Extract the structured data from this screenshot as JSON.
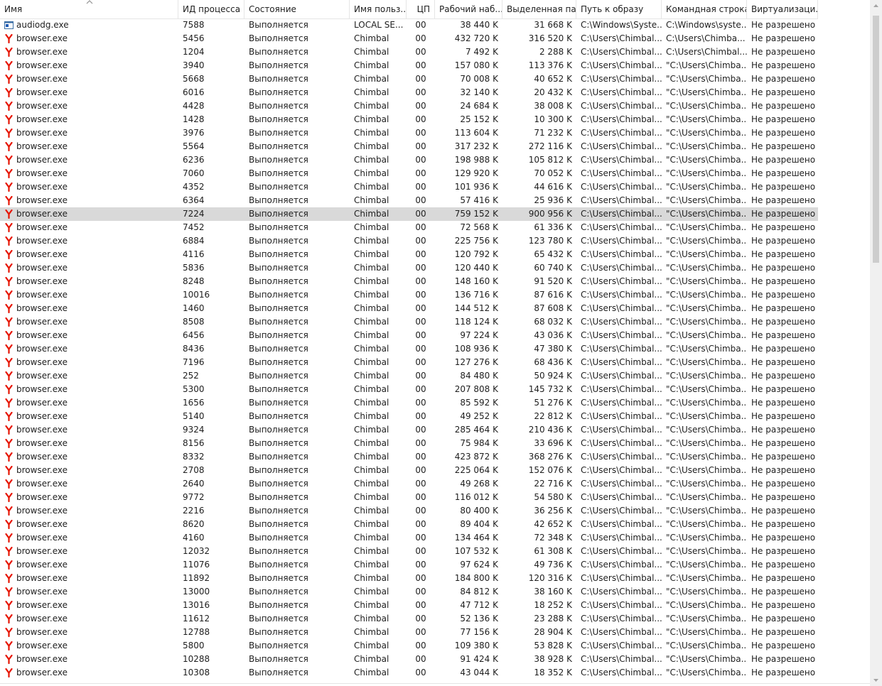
{
  "columns": [
    {
      "label": "Имя"
    },
    {
      "label": "ИД процесса"
    },
    {
      "label": "Состояние"
    },
    {
      "label": "Имя польз..."
    },
    {
      "label": "ЦП"
    },
    {
      "label": "Рабочий наб..."
    },
    {
      "label": "Выделенная па..."
    },
    {
      "label": "Путь к образу"
    },
    {
      "label": "Командная строка"
    },
    {
      "label": "Виртуализаци..."
    }
  ],
  "sort": {
    "column": "Имя",
    "direction": "ascending"
  },
  "selected_pid": "7224",
  "colors": {
    "selection": "#d9d9d9",
    "yandex_red": "#e61400",
    "grid": "#e5e5e5"
  },
  "rows": [
    {
      "icon": "audiodg-icon",
      "name": "audiodg.exe",
      "pid": "7588",
      "status": "Выполняется",
      "user": "LOCAL SE...",
      "cpu": "00",
      "ws": "38 440 K",
      "commit": "31 668 K",
      "path": "C:\\Windows\\Syste...",
      "cmd": "C:\\Windows\\syste...",
      "virt": "Не разрешено"
    },
    {
      "icon": "yandex-browser-icon",
      "name": "browser.exe",
      "pid": "5456",
      "status": "Выполняется",
      "user": "Chimbal",
      "cpu": "00",
      "ws": "432 720 K",
      "commit": "316 520 K",
      "path": "C:\\Users\\Chimbal...",
      "cmd": "C:\\Users\\Chimba...",
      "virt": "Не разрешено"
    },
    {
      "icon": "yandex-browser-icon",
      "name": "browser.exe",
      "pid": "1204",
      "status": "Выполняется",
      "user": "Chimbal",
      "cpu": "00",
      "ws": "7 492 K",
      "commit": "2 288 K",
      "path": "C:\\Users\\Chimbal...",
      "cmd": "C:\\Users\\Chimbal...",
      "virt": "Не разрешено"
    },
    {
      "icon": "yandex-browser-icon",
      "name": "browser.exe",
      "pid": "3940",
      "status": "Выполняется",
      "user": "Chimbal",
      "cpu": "00",
      "ws": "157 080 K",
      "commit": "113 376 K",
      "path": "C:\\Users\\Chimbal...",
      "cmd": "\"C:\\Users\\Chimba...",
      "virt": "Не разрешено"
    },
    {
      "icon": "yandex-browser-icon",
      "name": "browser.exe",
      "pid": "5668",
      "status": "Выполняется",
      "user": "Chimbal",
      "cpu": "00",
      "ws": "70 008 K",
      "commit": "40 652 K",
      "path": "C:\\Users\\Chimbal...",
      "cmd": "\"C:\\Users\\Chimba...",
      "virt": "Не разрешено"
    },
    {
      "icon": "yandex-browser-icon",
      "name": "browser.exe",
      "pid": "6016",
      "status": "Выполняется",
      "user": "Chimbal",
      "cpu": "00",
      "ws": "32 140 K",
      "commit": "20 432 K",
      "path": "C:\\Users\\Chimbal...",
      "cmd": "\"C:\\Users\\Chimba...",
      "virt": "Не разрешено"
    },
    {
      "icon": "yandex-browser-icon",
      "name": "browser.exe",
      "pid": "4428",
      "status": "Выполняется",
      "user": "Chimbal",
      "cpu": "00",
      "ws": "24 684 K",
      "commit": "38 008 K",
      "path": "C:\\Users\\Chimbal...",
      "cmd": "\"C:\\Users\\Chimba...",
      "virt": "Не разрешено"
    },
    {
      "icon": "yandex-browser-icon",
      "name": "browser.exe",
      "pid": "1428",
      "status": "Выполняется",
      "user": "Chimbal",
      "cpu": "00",
      "ws": "25 152 K",
      "commit": "10 300 K",
      "path": "C:\\Users\\Chimbal...",
      "cmd": "\"C:\\Users\\Chimba...",
      "virt": "Не разрешено"
    },
    {
      "icon": "yandex-browser-icon",
      "name": "browser.exe",
      "pid": "3976",
      "status": "Выполняется",
      "user": "Chimbal",
      "cpu": "00",
      "ws": "113 604 K",
      "commit": "71 232 K",
      "path": "C:\\Users\\Chimbal...",
      "cmd": "\"C:\\Users\\Chimba...",
      "virt": "Не разрешено"
    },
    {
      "icon": "yandex-browser-icon",
      "name": "browser.exe",
      "pid": "5564",
      "status": "Выполняется",
      "user": "Chimbal",
      "cpu": "00",
      "ws": "317 232 K",
      "commit": "272 116 K",
      "path": "C:\\Users\\Chimbal...",
      "cmd": "\"C:\\Users\\Chimba...",
      "virt": "Не разрешено"
    },
    {
      "icon": "yandex-browser-icon",
      "name": "browser.exe",
      "pid": "6236",
      "status": "Выполняется",
      "user": "Chimbal",
      "cpu": "00",
      "ws": "198 988 K",
      "commit": "105 812 K",
      "path": "C:\\Users\\Chimbal...",
      "cmd": "\"C:\\Users\\Chimba...",
      "virt": "Не разрешено"
    },
    {
      "icon": "yandex-browser-icon",
      "name": "browser.exe",
      "pid": "7060",
      "status": "Выполняется",
      "user": "Chimbal",
      "cpu": "00",
      "ws": "129 920 K",
      "commit": "70 052 K",
      "path": "C:\\Users\\Chimbal...",
      "cmd": "\"C:\\Users\\Chimba...",
      "virt": "Не разрешено"
    },
    {
      "icon": "yandex-browser-icon",
      "name": "browser.exe",
      "pid": "4352",
      "status": "Выполняется",
      "user": "Chimbal",
      "cpu": "00",
      "ws": "101 936 K",
      "commit": "44 616 K",
      "path": "C:\\Users\\Chimbal...",
      "cmd": "\"C:\\Users\\Chimba...",
      "virt": "Не разрешено"
    },
    {
      "icon": "yandex-browser-icon",
      "name": "browser.exe",
      "pid": "6364",
      "status": "Выполняется",
      "user": "Chimbal",
      "cpu": "00",
      "ws": "57 416 K",
      "commit": "25 936 K",
      "path": "C:\\Users\\Chimbal...",
      "cmd": "\"C:\\Users\\Chimba...",
      "virt": "Не разрешено"
    },
    {
      "icon": "yandex-browser-icon",
      "name": "browser.exe",
      "pid": "7224",
      "status": "Выполняется",
      "user": "Chimbal",
      "cpu": "00",
      "ws": "759 152 K",
      "commit": "900 956 K",
      "path": "C:\\Users\\Chimbal...",
      "cmd": "\"C:\\Users\\Chimba...",
      "virt": "Не разрешено"
    },
    {
      "icon": "yandex-browser-icon",
      "name": "browser.exe",
      "pid": "7452",
      "status": "Выполняется",
      "user": "Chimbal",
      "cpu": "00",
      "ws": "72 568 K",
      "commit": "61 336 K",
      "path": "C:\\Users\\Chimbal...",
      "cmd": "\"C:\\Users\\Chimba...",
      "virt": "Не разрешено"
    },
    {
      "icon": "yandex-browser-icon",
      "name": "browser.exe",
      "pid": "6884",
      "status": "Выполняется",
      "user": "Chimbal",
      "cpu": "00",
      "ws": "225 756 K",
      "commit": "123 780 K",
      "path": "C:\\Users\\Chimbal...",
      "cmd": "\"C:\\Users\\Chimba...",
      "virt": "Не разрешено"
    },
    {
      "icon": "yandex-browser-icon",
      "name": "browser.exe",
      "pid": "4116",
      "status": "Выполняется",
      "user": "Chimbal",
      "cpu": "00",
      "ws": "120 792 K",
      "commit": "65 432 K",
      "path": "C:\\Users\\Chimbal...",
      "cmd": "\"C:\\Users\\Chimba...",
      "virt": "Не разрешено"
    },
    {
      "icon": "yandex-browser-icon",
      "name": "browser.exe",
      "pid": "5836",
      "status": "Выполняется",
      "user": "Chimbal",
      "cpu": "00",
      "ws": "120 440 K",
      "commit": "60 740 K",
      "path": "C:\\Users\\Chimbal...",
      "cmd": "\"C:\\Users\\Chimba...",
      "virt": "Не разрешено"
    },
    {
      "icon": "yandex-browser-icon",
      "name": "browser.exe",
      "pid": "8248",
      "status": "Выполняется",
      "user": "Chimbal",
      "cpu": "00",
      "ws": "148 160 K",
      "commit": "91 520 K",
      "path": "C:\\Users\\Chimbal...",
      "cmd": "\"C:\\Users\\Chimba...",
      "virt": "Не разрешено"
    },
    {
      "icon": "yandex-browser-icon",
      "name": "browser.exe",
      "pid": "10016",
      "status": "Выполняется",
      "user": "Chimbal",
      "cpu": "00",
      "ws": "136 716 K",
      "commit": "87 616 K",
      "path": "C:\\Users\\Chimbal...",
      "cmd": "\"C:\\Users\\Chimba...",
      "virt": "Не разрешено"
    },
    {
      "icon": "yandex-browser-icon",
      "name": "browser.exe",
      "pid": "1460",
      "status": "Выполняется",
      "user": "Chimbal",
      "cpu": "00",
      "ws": "144 512 K",
      "commit": "87 608 K",
      "path": "C:\\Users\\Chimbal...",
      "cmd": "\"C:\\Users\\Chimba...",
      "virt": "Не разрешено"
    },
    {
      "icon": "yandex-browser-icon",
      "name": "browser.exe",
      "pid": "8508",
      "status": "Выполняется",
      "user": "Chimbal",
      "cpu": "00",
      "ws": "118 124 K",
      "commit": "68 032 K",
      "path": "C:\\Users\\Chimbal...",
      "cmd": "\"C:\\Users\\Chimba...",
      "virt": "Не разрешено"
    },
    {
      "icon": "yandex-browser-icon",
      "name": "browser.exe",
      "pid": "6456",
      "status": "Выполняется",
      "user": "Chimbal",
      "cpu": "00",
      "ws": "97 224 K",
      "commit": "43 036 K",
      "path": "C:\\Users\\Chimbal...",
      "cmd": "\"C:\\Users\\Chimba...",
      "virt": "Не разрешено"
    },
    {
      "icon": "yandex-browser-icon",
      "name": "browser.exe",
      "pid": "8436",
      "status": "Выполняется",
      "user": "Chimbal",
      "cpu": "00",
      "ws": "108 936 K",
      "commit": "47 380 K",
      "path": "C:\\Users\\Chimbal...",
      "cmd": "\"C:\\Users\\Chimba...",
      "virt": "Не разрешено"
    },
    {
      "icon": "yandex-browser-icon",
      "name": "browser.exe",
      "pid": "7196",
      "status": "Выполняется",
      "user": "Chimbal",
      "cpu": "00",
      "ws": "127 276 K",
      "commit": "68 436 K",
      "path": "C:\\Users\\Chimbal...",
      "cmd": "\"C:\\Users\\Chimba...",
      "virt": "Не разрешено"
    },
    {
      "icon": "yandex-browser-icon",
      "name": "browser.exe",
      "pid": "252",
      "status": "Выполняется",
      "user": "Chimbal",
      "cpu": "00",
      "ws": "84 480 K",
      "commit": "50 924 K",
      "path": "C:\\Users\\Chimbal...",
      "cmd": "\"C:\\Users\\Chimba...",
      "virt": "Не разрешено"
    },
    {
      "icon": "yandex-browser-icon",
      "name": "browser.exe",
      "pid": "5300",
      "status": "Выполняется",
      "user": "Chimbal",
      "cpu": "00",
      "ws": "207 808 K",
      "commit": "145 732 K",
      "path": "C:\\Users\\Chimbal...",
      "cmd": "\"C:\\Users\\Chimba...",
      "virt": "Не разрешено"
    },
    {
      "icon": "yandex-browser-icon",
      "name": "browser.exe",
      "pid": "1656",
      "status": "Выполняется",
      "user": "Chimbal",
      "cpu": "00",
      "ws": "85 592 K",
      "commit": "51 276 K",
      "path": "C:\\Users\\Chimbal...",
      "cmd": "\"C:\\Users\\Chimba...",
      "virt": "Не разрешено"
    },
    {
      "icon": "yandex-browser-icon",
      "name": "browser.exe",
      "pid": "5140",
      "status": "Выполняется",
      "user": "Chimbal",
      "cpu": "00",
      "ws": "49 252 K",
      "commit": "22 812 K",
      "path": "C:\\Users\\Chimbal...",
      "cmd": "\"C:\\Users\\Chimba...",
      "virt": "Не разрешено"
    },
    {
      "icon": "yandex-browser-icon",
      "name": "browser.exe",
      "pid": "9324",
      "status": "Выполняется",
      "user": "Chimbal",
      "cpu": "00",
      "ws": "285 464 K",
      "commit": "210 436 K",
      "path": "C:\\Users\\Chimbal...",
      "cmd": "\"C:\\Users\\Chimba...",
      "virt": "Не разрешено"
    },
    {
      "icon": "yandex-browser-icon",
      "name": "browser.exe",
      "pid": "8156",
      "status": "Выполняется",
      "user": "Chimbal",
      "cpu": "00",
      "ws": "75 984 K",
      "commit": "33 696 K",
      "path": "C:\\Users\\Chimbal...",
      "cmd": "\"C:\\Users\\Chimba...",
      "virt": "Не разрешено"
    },
    {
      "icon": "yandex-browser-icon",
      "name": "browser.exe",
      "pid": "8332",
      "status": "Выполняется",
      "user": "Chimbal",
      "cpu": "00",
      "ws": "423 872 K",
      "commit": "368 276 K",
      "path": "C:\\Users\\Chimbal...",
      "cmd": "\"C:\\Users\\Chimba...",
      "virt": "Не разрешено"
    },
    {
      "icon": "yandex-browser-icon",
      "name": "browser.exe",
      "pid": "2708",
      "status": "Выполняется",
      "user": "Chimbal",
      "cpu": "00",
      "ws": "225 064 K",
      "commit": "152 076 K",
      "path": "C:\\Users\\Chimbal...",
      "cmd": "\"C:\\Users\\Chimba...",
      "virt": "Не разрешено"
    },
    {
      "icon": "yandex-browser-icon",
      "name": "browser.exe",
      "pid": "2640",
      "status": "Выполняется",
      "user": "Chimbal",
      "cpu": "00",
      "ws": "49 268 K",
      "commit": "22 716 K",
      "path": "C:\\Users\\Chimbal...",
      "cmd": "\"C:\\Users\\Chimba...",
      "virt": "Не разрешено"
    },
    {
      "icon": "yandex-browser-icon",
      "name": "browser.exe",
      "pid": "9772",
      "status": "Выполняется",
      "user": "Chimbal",
      "cpu": "00",
      "ws": "116 012 K",
      "commit": "54 580 K",
      "path": "C:\\Users\\Chimbal...",
      "cmd": "\"C:\\Users\\Chimba...",
      "virt": "Не разрешено"
    },
    {
      "icon": "yandex-browser-icon",
      "name": "browser.exe",
      "pid": "2216",
      "status": "Выполняется",
      "user": "Chimbal",
      "cpu": "00",
      "ws": "80 400 K",
      "commit": "36 256 K",
      "path": "C:\\Users\\Chimbal...",
      "cmd": "\"C:\\Users\\Chimba...",
      "virt": "Не разрешено"
    },
    {
      "icon": "yandex-browser-icon",
      "name": "browser.exe",
      "pid": "8620",
      "status": "Выполняется",
      "user": "Chimbal",
      "cpu": "00",
      "ws": "89 404 K",
      "commit": "42 652 K",
      "path": "C:\\Users\\Chimbal...",
      "cmd": "\"C:\\Users\\Chimba...",
      "virt": "Не разрешено"
    },
    {
      "icon": "yandex-browser-icon",
      "name": "browser.exe",
      "pid": "4160",
      "status": "Выполняется",
      "user": "Chimbal",
      "cpu": "00",
      "ws": "134 464 K",
      "commit": "72 348 K",
      "path": "C:\\Users\\Chimbal...",
      "cmd": "\"C:\\Users\\Chimba...",
      "virt": "Не разрешено"
    },
    {
      "icon": "yandex-browser-icon",
      "name": "browser.exe",
      "pid": "12032",
      "status": "Выполняется",
      "user": "Chimbal",
      "cpu": "00",
      "ws": "107 532 K",
      "commit": "61 308 K",
      "path": "C:\\Users\\Chimbal...",
      "cmd": "\"C:\\Users\\Chimba...",
      "virt": "Не разрешено"
    },
    {
      "icon": "yandex-browser-icon",
      "name": "browser.exe",
      "pid": "11076",
      "status": "Выполняется",
      "user": "Chimbal",
      "cpu": "00",
      "ws": "97 624 K",
      "commit": "49 736 K",
      "path": "C:\\Users\\Chimbal...",
      "cmd": "\"C:\\Users\\Chimba...",
      "virt": "Не разрешено"
    },
    {
      "icon": "yandex-browser-icon",
      "name": "browser.exe",
      "pid": "11892",
      "status": "Выполняется",
      "user": "Chimbal",
      "cpu": "00",
      "ws": "184 800 K",
      "commit": "120 316 K",
      "path": "C:\\Users\\Chimbal...",
      "cmd": "\"C:\\Users\\Chimba...",
      "virt": "Не разрешено"
    },
    {
      "icon": "yandex-browser-icon",
      "name": "browser.exe",
      "pid": "13000",
      "status": "Выполняется",
      "user": "Chimbal",
      "cpu": "00",
      "ws": "84 812 K",
      "commit": "38 160 K",
      "path": "C:\\Users\\Chimbal...",
      "cmd": "\"C:\\Users\\Chimba...",
      "virt": "Не разрешено"
    },
    {
      "icon": "yandex-browser-icon",
      "name": "browser.exe",
      "pid": "13016",
      "status": "Выполняется",
      "user": "Chimbal",
      "cpu": "00",
      "ws": "47 712 K",
      "commit": "18 252 K",
      "path": "C:\\Users\\Chimbal...",
      "cmd": "\"C:\\Users\\Chimba...",
      "virt": "Не разрешено"
    },
    {
      "icon": "yandex-browser-icon",
      "name": "browser.exe",
      "pid": "11612",
      "status": "Выполняется",
      "user": "Chimbal",
      "cpu": "00",
      "ws": "52 136 K",
      "commit": "23 288 K",
      "path": "C:\\Users\\Chimbal...",
      "cmd": "\"C:\\Users\\Chimba...",
      "virt": "Не разрешено"
    },
    {
      "icon": "yandex-browser-icon",
      "name": "browser.exe",
      "pid": "12788",
      "status": "Выполняется",
      "user": "Chimbal",
      "cpu": "00",
      "ws": "77 156 K",
      "commit": "28 904 K",
      "path": "C:\\Users\\Chimbal...",
      "cmd": "\"C:\\Users\\Chimba...",
      "virt": "Не разрешено"
    },
    {
      "icon": "yandex-browser-icon",
      "name": "browser.exe",
      "pid": "5800",
      "status": "Выполняется",
      "user": "Chimbal",
      "cpu": "00",
      "ws": "109 380 K",
      "commit": "53 828 K",
      "path": "C:\\Users\\Chimbal...",
      "cmd": "\"C:\\Users\\Chimba...",
      "virt": "Не разрешено"
    },
    {
      "icon": "yandex-browser-icon",
      "name": "browser.exe",
      "pid": "10288",
      "status": "Выполняется",
      "user": "Chimbal",
      "cpu": "00",
      "ws": "91 424 K",
      "commit": "38 928 K",
      "path": "C:\\Users\\Chimbal...",
      "cmd": "\"C:\\Users\\Chimba...",
      "virt": "Не разрешено"
    },
    {
      "icon": "yandex-browser-icon",
      "name": "browser.exe",
      "pid": "10308",
      "status": "Выполняется",
      "user": "Chimbal",
      "cpu": "00",
      "ws": "43 044 K",
      "commit": "18 352 K",
      "path": "C:\\Users\\Chimbal...",
      "cmd": "\"C:\\Users\\Chimba...",
      "virt": "Не разрешено"
    }
  ]
}
